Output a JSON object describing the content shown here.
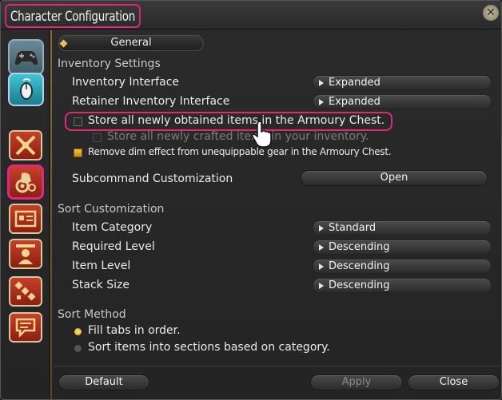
{
  "window": {
    "title": "Character Configuration"
  },
  "sidebar": {
    "mode_tabs": [
      {
        "name": "gamepad-mode-tab",
        "icon": "gamepad-icon"
      },
      {
        "name": "mouse-mode-tab",
        "icon": "mouse-icon"
      }
    ],
    "categories": [
      {
        "icon": "battle-icon"
      },
      {
        "icon": "items-gear-icon",
        "active": true
      },
      {
        "icon": "hud-card-icon"
      },
      {
        "icon": "nameplate-icon"
      },
      {
        "icon": "party-list-icon"
      },
      {
        "icon": "chat-icon"
      }
    ]
  },
  "section_tab": {
    "label": "General"
  },
  "inventory": {
    "heading": "Inventory Settings",
    "inventory_interface": {
      "label": "Inventory Interface",
      "value": "Expanded"
    },
    "retainer_interface": {
      "label": "Retainer Inventory Interface",
      "value": "Expanded"
    },
    "armoury_store": {
      "label": "Store all newly obtained items in the Armoury Chest.",
      "checked": false
    },
    "crafted_store": {
      "label": "Store all newly crafted items in your inventory.",
      "checked": false,
      "disabled": true
    },
    "dim_effect": {
      "label": "Remove dim effect from unequippable gear in the Armoury Chest.",
      "checked": true
    },
    "subcommand": {
      "label": "Subcommand Customization",
      "button": "Open"
    }
  },
  "sort": {
    "heading": "Sort Customization",
    "item_category": {
      "label": "Item Category",
      "value": "Standard"
    },
    "required_level": {
      "label": "Required Level",
      "value": "Descending"
    },
    "item_level": {
      "label": "Item Level",
      "value": "Descending"
    },
    "stack_size": {
      "label": "Stack Size",
      "value": "Descending"
    }
  },
  "sort_method": {
    "heading": "Sort Method",
    "option_fill": {
      "label": "Fill tabs in order.",
      "selected": true
    },
    "option_sections": {
      "label": "Sort items into sections based on category.",
      "selected": false
    }
  },
  "footer": {
    "default": "Default",
    "apply": "Apply",
    "close": "Close"
  },
  "colors": {
    "highlight": "#e0287a",
    "accent": "#e8c252",
    "sidebar_icon": "#c5402a"
  }
}
